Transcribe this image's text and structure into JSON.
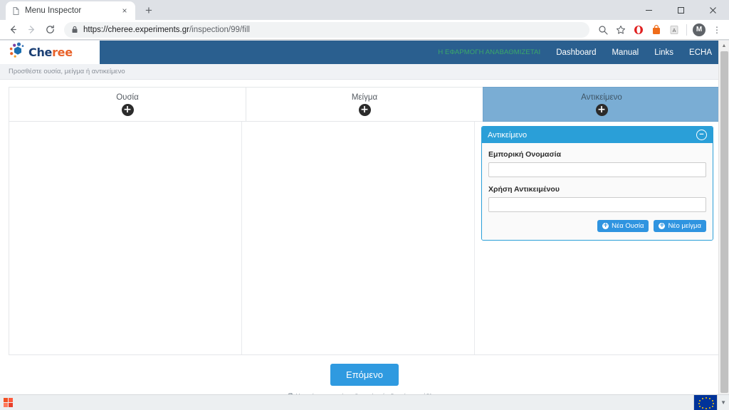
{
  "browser": {
    "tab": {
      "title": "Menu Inspector",
      "favicon": "document-icon",
      "close": "×"
    },
    "new_tab_label": "+",
    "window_controls": {
      "minimize": "–",
      "maximize": "☐",
      "close": "✕"
    },
    "nav": {
      "back": "←",
      "forward": "→",
      "reload": "⟳"
    },
    "omnibox": {
      "scheme": "https://",
      "host": "cheree.experiments.gr",
      "path": "/inspection/99/fill",
      "full_url": "https://cheree.experiments.gr/inspection/99/fill",
      "lock": "lock-icon"
    },
    "toolbar_icons": [
      "search-icon",
      "bookmark-star-icon",
      "opera-extension-icon",
      "shopping-bag-icon",
      "adobe-acrobat-icon"
    ],
    "profile_initial": "M",
    "menu_glyph": "⋮"
  },
  "site": {
    "logo": {
      "text_primary": "Che",
      "text_accent": "ree",
      "icon": "molecule-dots-icon"
    },
    "alert_text": "Η ΕΦΑΡΜΟΓΗ ΑΝΑΒΑΘΜΙΖΕΤΑΙ",
    "alert_color": "#3aa86a",
    "nav_links": [
      {
        "label": "Dashboard"
      },
      {
        "label": "Manual"
      },
      {
        "label": "Links"
      },
      {
        "label": "ECHA"
      }
    ],
    "navbar_color": "#2a5f8f"
  },
  "breadcrumb": "Προσθέστε ουσία, μείγμα ή αντικείμενο",
  "tiles": [
    {
      "label": "Ουσία",
      "active": false,
      "add_icon": "plus-circle-icon"
    },
    {
      "label": "Μείγμα",
      "active": false,
      "add_icon": "plus-circle-icon"
    },
    {
      "label": "Αντικείμενο",
      "active": true,
      "add_icon": "plus-circle-icon"
    }
  ],
  "object_card": {
    "title": "Αντικείμενο",
    "collapse_icon": "minus-circle-icon",
    "header_color": "#2a9fd8",
    "fields": [
      {
        "label": "Εμπορική Ονομασία",
        "value": "",
        "placeholder": ""
      },
      {
        "label": "Χρήση Αντικειμένου",
        "value": "",
        "placeholder": ""
      }
    ],
    "actions": [
      {
        "label": "Νέα Ουσία",
        "icon": "plus-circle-icon"
      },
      {
        "label": "Νέο μείγμα",
        "icon": "plus-circle-icon"
      }
    ]
  },
  "footer": {
    "next_button": "Επόμενο",
    "note": "Η ουσία και το μείγμα θεωρείται ότι δεν είναι απόβλητα",
    "note_icon": "info-circle-icon"
  },
  "taskbar": {
    "start_icon": "windows-flag-icon",
    "tray_flag": "eu-flag-icon",
    "tray_caret": "▼"
  }
}
